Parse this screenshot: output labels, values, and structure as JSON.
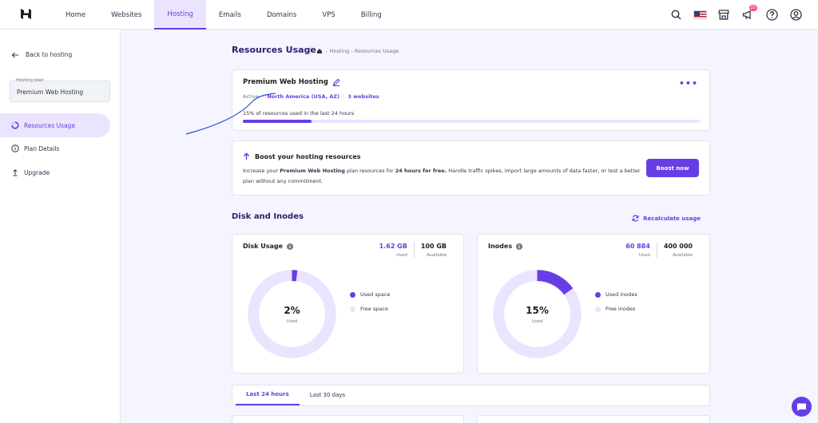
{
  "nav": {
    "items": [
      "Home",
      "Websites",
      "Hosting",
      "Emails",
      "Domains",
      "VPS",
      "Billing"
    ],
    "active": "Hosting",
    "notification_count": "23"
  },
  "icons": {
    "logo": "hostinger-logo-icon",
    "search": "search-icon",
    "flag": "us-flag-icon",
    "store": "store-icon",
    "megaphone": "megaphone-icon",
    "help": "help-icon",
    "account": "account-icon"
  },
  "sidebar": {
    "back_label": "Back to hosting",
    "plan_label": "Hosting plan",
    "plan_value": "Premium Web Hosting",
    "items": [
      {
        "label": "Resources Usage",
        "icon": "progress-ring-icon"
      },
      {
        "label": "Plan Details",
        "icon": "info-icon"
      },
      {
        "label": "Upgrade",
        "icon": "upgrade-arrow-icon"
      }
    ]
  },
  "page": {
    "title": "Resources Usage",
    "breadcrumb": "- Hosting - Resources Usage"
  },
  "plan_card": {
    "title": "Premium Web Hosting",
    "status": "Active",
    "location": "North America (USA, AZ)",
    "websites": "3 websites",
    "usage_text": "15% of resources used in the last 24 hours",
    "usage_percent": 15
  },
  "boost": {
    "title": "Boost your hosting resources",
    "desc_1": "Increase your ",
    "desc_plan": "Premium Web Hosting",
    "desc_2": " plan resources for ",
    "desc_time": "24 hours for free.",
    "desc_3": " Handle traffic spikes, import large amounts of data faster, or test a better plan without any commitment.",
    "button": "Boost now"
  },
  "disk_section": {
    "title": "Disk and Inodes",
    "recalc": "Recalculate usage"
  },
  "disk": {
    "title": "Disk Usage",
    "used": "1.62 GB",
    "used_label": "Used",
    "available": "100 GB",
    "available_label": "Available",
    "percent_text": "2%",
    "percent": 2,
    "center_label": "Used",
    "legend_used": "Used space",
    "legend_free": "Free space"
  },
  "inodes": {
    "title": "Inodes",
    "used": "60 884",
    "used_label": "Used",
    "available": "400 000",
    "available_label": "Available",
    "percent_text": "15%",
    "percent": 15,
    "center_label": "Used",
    "legend_used": "Used inodes",
    "legend_free": "Free inodes"
  },
  "tabs": [
    "Last 24 hours",
    "Last 30 days"
  ],
  "colors": {
    "accent": "#673de6",
    "accent_light": "#ebe4ff",
    "background": "#f4f5ff"
  }
}
